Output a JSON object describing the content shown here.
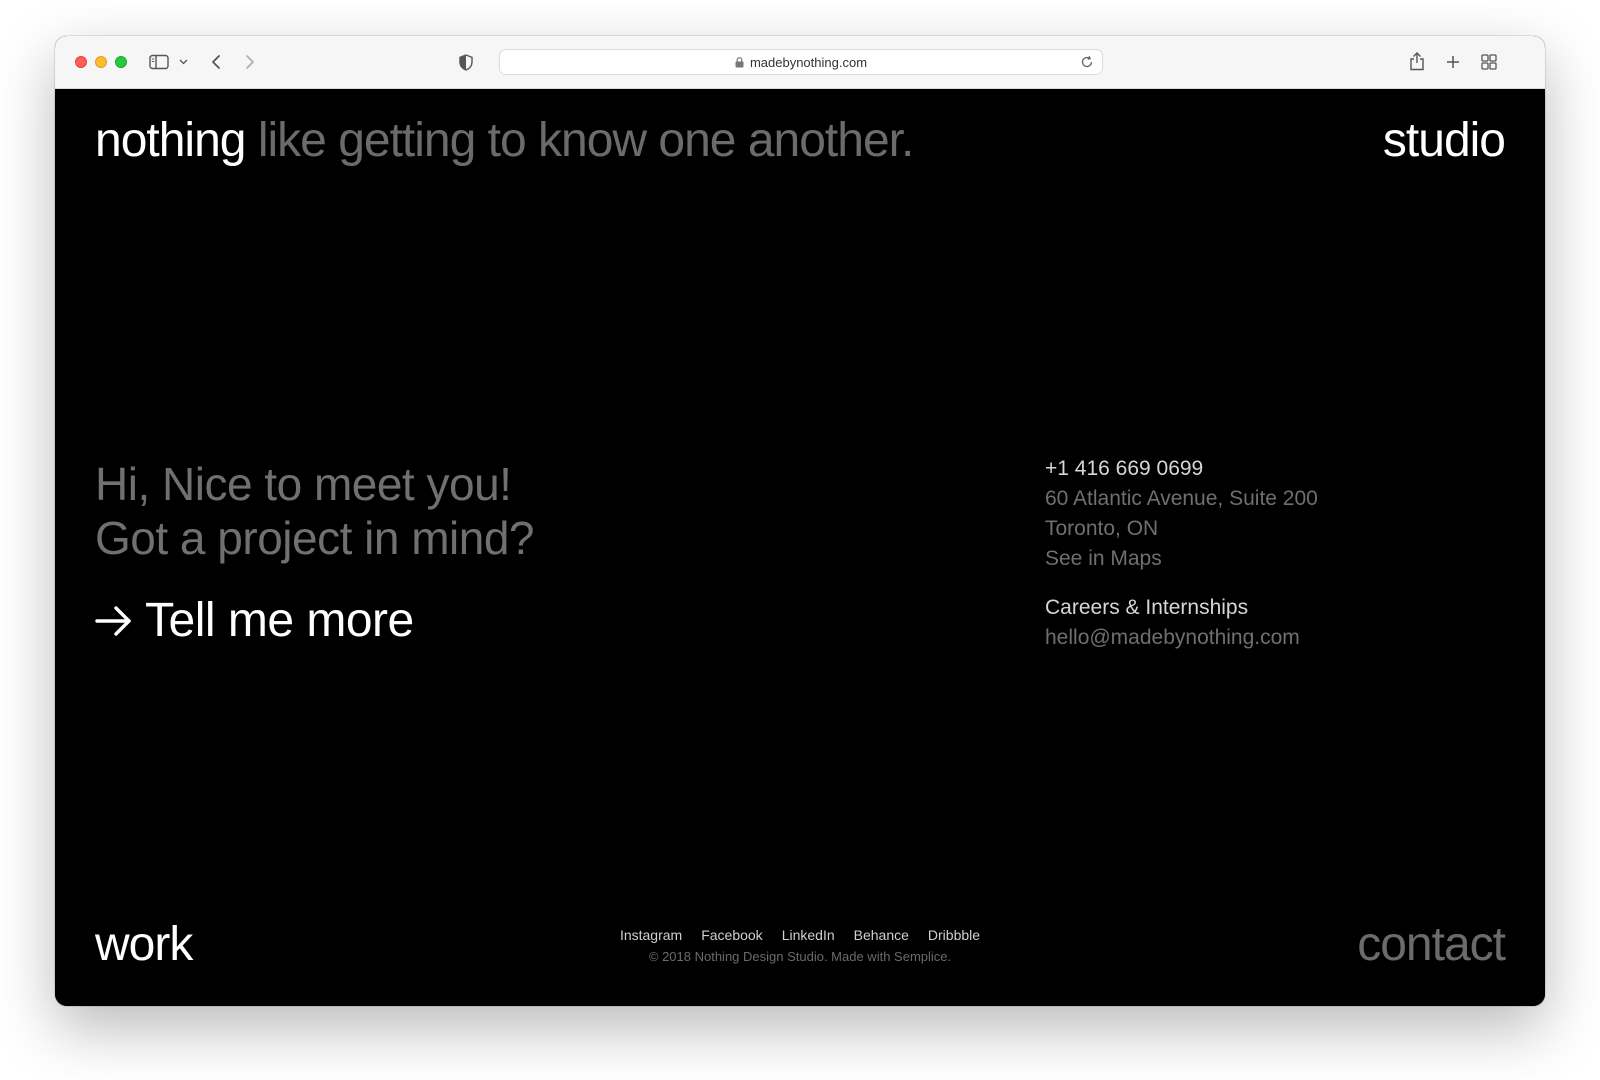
{
  "browser": {
    "url": "madebynothing.com"
  },
  "hero": {
    "brand": "nothing",
    "tagline": "like getting to know one another.",
    "section_label": "studio"
  },
  "greeting": {
    "line1": "Hi, Nice to meet you!",
    "line2": "Got a project in mind?"
  },
  "cta": {
    "label": "Tell me more",
    "icon": "arrow-right-icon"
  },
  "contact_info": {
    "phone": "+1 416 669 0699",
    "address_line1": "60 Atlantic Avenue, Suite 200",
    "address_line2": "Toronto, ON",
    "maps_link": "See in Maps",
    "careers": "Careers & Internships",
    "email": "hello@madebynothing.com"
  },
  "footer": {
    "work": "work",
    "contact": "contact",
    "social": [
      "Instagram",
      "Facebook",
      "LinkedIn",
      "Behance",
      "Dribbble"
    ],
    "copyright": "© 2018 Nothing Design Studio. Made with Semplice."
  },
  "colors": {
    "background": "#000000",
    "primary_text": "#ffffff",
    "muted_text": "#6b6b6b"
  }
}
